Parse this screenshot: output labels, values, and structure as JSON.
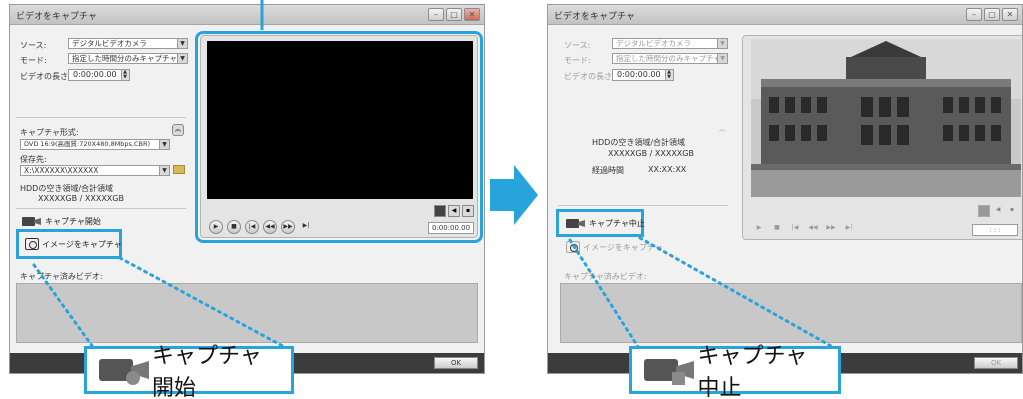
{
  "left": {
    "title": "ビデオをキャプチャ",
    "source_label": "ソース:",
    "source_value": "デジタルビデオカメラ",
    "mode_label": "モード:",
    "mode_value": "指定した時間分のみキャプチャ",
    "length_label": "ビデオの長さ:",
    "length_value": "0:00:00.00",
    "format_label": "キャプチャ形式:",
    "format_value": "DVD 16:9(高画質:720X480,8Mbps,CBR)",
    "save_label": "保存先:",
    "save_value": "X:\\XXXXXX\\XXXXXX",
    "hdd_label": "HDDの空き領域/合計領域",
    "hdd_value": "XXXXXGB / XXXXXGB",
    "capture_start": "キャプチャ開始",
    "capture_image": "イメージをキャプチャ",
    "captured_label": "キャプチャ済みビデオ:",
    "timecode": "0:00:00.00",
    "ok_label": "OK"
  },
  "right": {
    "title": "ビデオをキャプチャ",
    "source_label": "ソース:",
    "source_value": "デジタルビデオカメラ",
    "mode_label": "モード:",
    "mode_value": "指定した時間分のみキャプチャ",
    "length_label": "ビデオの長さ:",
    "length_value": "0:00:00.00",
    "hdd_label": "HDDの空き領域/合計領域",
    "hdd_value": "XXXXXGB / XXXXXGB",
    "elapsed_label": "経過時間",
    "elapsed_value": "XX:XX:XX",
    "capture_stop": "キャプチャ中止",
    "capture_image": "イメージをキャプチャ",
    "captured_label": "キャプチャ済みビデオ:",
    "timecode": ": : :",
    "ok_label": "OK"
  },
  "callouts": {
    "start": "キャプチャ開始",
    "stop": "キャプチャ中止"
  },
  "colors": {
    "highlight": "#29a3dc",
    "arrow": "#29a3dc"
  },
  "icons": {
    "camera": "video-camera-icon",
    "still": "still-camera-icon",
    "play": "▶",
    "stop": "■",
    "prev": "|◀",
    "rew": "◀◀",
    "ff": "▶▶",
    "next": "▶|"
  }
}
